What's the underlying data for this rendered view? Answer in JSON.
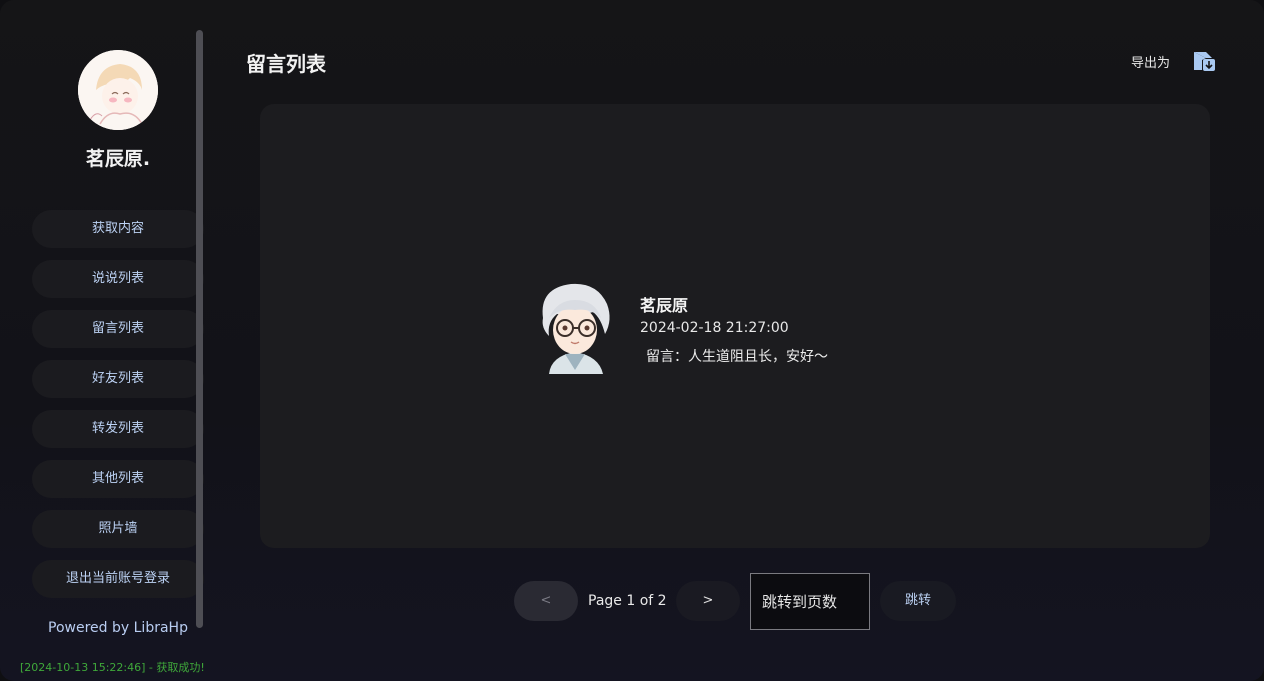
{
  "sidebar": {
    "username": "茗辰原.",
    "items": [
      {
        "label": "获取内容"
      },
      {
        "label": "说说列表"
      },
      {
        "label": "留言列表"
      },
      {
        "label": "好友列表"
      },
      {
        "label": "转发列表"
      },
      {
        "label": "其他列表"
      },
      {
        "label": "照片墙"
      },
      {
        "label": "退出当前账号登录"
      }
    ],
    "powered_by": "Powered by LibraHp",
    "log": "[2024-10-13 15:22:46] - 获取成功!"
  },
  "header": {
    "title": "留言列表",
    "export_label": "导出为",
    "export_icon": "export-icon"
  },
  "message": {
    "name": "茗辰原",
    "time": "2024-02-18 21:27:00",
    "text": "留言：人生道阻且长，安好～"
  },
  "pagination": {
    "prev_label": "<",
    "page_info": "Page 1 of 2",
    "next_label": ">",
    "jump_placeholder": "跳转到页数",
    "jump_button": "跳转"
  },
  "colors": {
    "accent_text": "#bcd2f4",
    "log_text": "#3fa83a",
    "export_icon": "#a9c9f2"
  }
}
